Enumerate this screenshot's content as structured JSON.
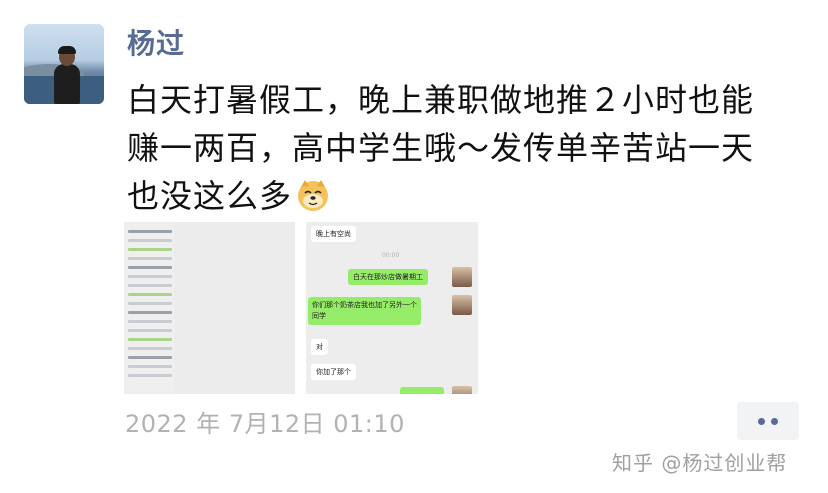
{
  "post": {
    "username": "杨过",
    "text_lines": [
      "白天打暑假工，晚上兼职做地推２小时也能",
      "赚一两百，高中学生哦～发传单辛苦站一天",
      "也没这么多"
    ],
    "emoji": "doge-emoji",
    "timestamp": "2022 年 7月12日 01:10"
  },
  "chat_screenshot": {
    "messages": [
      {
        "side": "left",
        "text": "晚上有空尚"
      },
      {
        "side": "time",
        "text": "00:00"
      },
      {
        "side": "right",
        "text": "白天在那炒店做暑期工"
      },
      {
        "side": "right",
        "text": "你们那个奶茶店我也加了另外一个"
      },
      {
        "side": "right",
        "text": "同学"
      },
      {
        "side": "left",
        "text": "对"
      },
      {
        "side": "left",
        "text": "你加了那个"
      }
    ]
  },
  "watermark": "知乎 @杨过创业帮",
  "colors": {
    "name_blue": "#576b95",
    "timestamp_gray": "#b2b2b2",
    "chat_green": "#95ec69"
  }
}
